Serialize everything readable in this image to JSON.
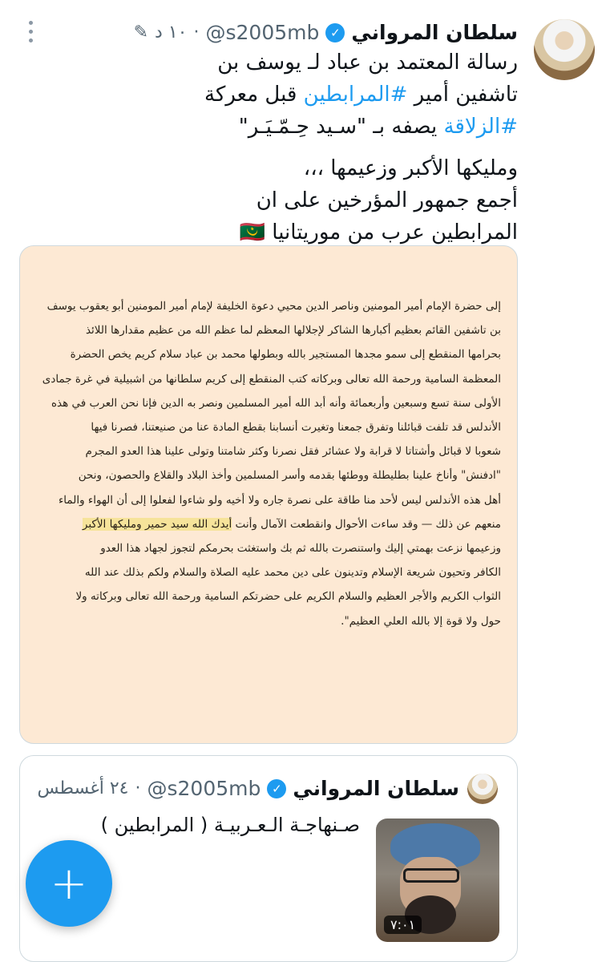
{
  "tweet": {
    "name": "سلطان المرواني",
    "handle": "@s2005mb",
    "time": "١٠ د",
    "text_lines": [
      "رسالة المعتمد بن عباد لـ يوسف بن",
      "تاشفين أمير #المرابطين قبل معركة",
      "#الزلاقة يصفه بـ \"سـيد حِـمّـيَـر\"",
      "ومليكها الأكبر وزعيمها ،،،",
      "أجمع جمهور المؤرخين على ان",
      "المرابطين عرب من موريتانيا 🇲🇷"
    ],
    "hashtags": [
      "#المرابطين",
      "#الزلاقة"
    ]
  },
  "document": {
    "lines": [
      "إلى حضرة الإمام أمير المومنين وناصر الدين محيي دعوة الخليفة لإمام أمير المومنين أبو يعقوب يوسف",
      "بن تاشفين القائم بعظيم أكبارها الشاكر لإجلالها المعظم لما عظم الله من عظيم مقدارها اللائذ",
      "بحرامها المنقطع إلى سمو مجدها المستجير بالله وبطولها محمد بن عباد سلام كريم يخص الحضرة",
      "المعظمة السامية ورحمة الله تعالى وبركاته كتب المنقطع إلى كريم سلطانها من اشبيلية في غرة جمادى",
      "الأولى سنة تسع وسبعين وأربعمائة وأنه أبد الله أمير المسلمين ونصر به الدين فإنا نحن العرب في هذه",
      "الأندلس قد تلفت قبائلنا وتفرق جمعنا وتغيرت أنسابنا بقطع المادة عنا من صنيعتنا، فصرنا فيها",
      "شعوبا لا قبائل وأشتاتا لا قرابة ولا عشائر فقل نصرنا وكثر شامتنا وتولى علينا هذا العدو المجرم",
      "\"ادفنش\" وأناخ علينا بطليطلة ووطئها بقدمه وأسر المسلمين وأخذ البلاد والقلاع والحصون، ونحن",
      "أهل هذه الأندلس ليس لأحد منا طاقة على نصرة جاره ولا أخيه ولو شاءوا لفعلوا إلى أن الهواء والماء",
      "منعهم عن ذلك — وقد ساءت الأحوال وانقطعت الآمال وأنت أيدك الله سيد حمير ومليكها الأكبر",
      "وزعيمها نزعت بهمتي إليك واستنصرت بالله ثم بك واستغثت بحرمكم لتجوز لجهاد هذا العدو",
      "الكافر وتحيون شريعة الإسلام وتدينون على دين محمد عليه الصلاة والسلام ولكم بذلك عند الله",
      "الثواب الكريم والأجر العظيم والسلام الكريم على حضرتكم السامية ورحمة الله تعالى وبركاته ولا",
      "حول ولا قوة إلا بالله العلي العظيم\"."
    ],
    "line10_plain": "منعهم عن ذلك — وقد ساءت الأحوال وانقطعت الآمال وأنت ",
    "line10_highlight": "أيدك الله سيد حمير ومليكها الأكبر"
  },
  "quoted": {
    "name": "سلطان المرواني",
    "handle": "@s2005mb",
    "date": "٢٤ أغسطس",
    "separator": "·",
    "text": "صـنهاجـة الـعـربيـة ( المرابطين )",
    "duration": "٧:٠١"
  },
  "fab": {
    "label": "+"
  }
}
